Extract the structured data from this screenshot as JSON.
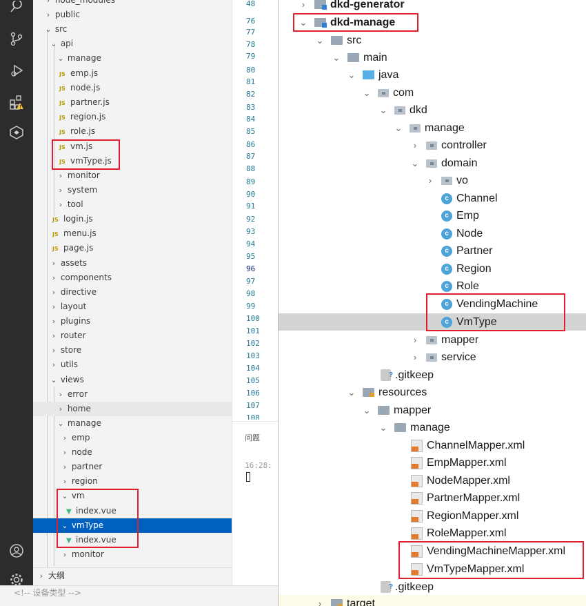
{
  "explorer": {
    "rows": [
      "node_modules",
      "public",
      "src",
      "api",
      "manage",
      "emp.js",
      "node.js",
      "partner.js",
      "region.js",
      "role.js",
      "vm.js",
      "vmType.js",
      "monitor",
      "system",
      "tool",
      "login.js",
      "menu.js",
      "page.js",
      "assets",
      "components",
      "directive",
      "layout",
      "plugins",
      "router",
      "store",
      "utils",
      "views",
      "error",
      "home",
      "manage",
      "emp",
      "node",
      "partner",
      "region",
      "vm",
      "index.vue",
      "vmType",
      "index.vue",
      "monitor"
    ],
    "outline_label": "大纲",
    "bottom_comment": "<!-- 设备类型 -->",
    "js_badge": "JS"
  },
  "gutter": {
    "lines": [
      "48",
      "76",
      "77",
      "78",
      "79",
      "80",
      "81",
      "82",
      "83",
      "84",
      "85",
      "86",
      "87",
      "88",
      "89",
      "90",
      "91",
      "92",
      "93",
      "94",
      "95",
      "96",
      "97",
      "98",
      "99",
      "100",
      "101",
      "102",
      "103",
      "104",
      "105",
      "106",
      "107",
      "108"
    ],
    "problems_label": "问题",
    "time_label": "16:28:"
  },
  "project": {
    "rows": [
      "dkd-generator",
      "dkd-manage",
      "src",
      "main",
      "java",
      "com",
      "dkd",
      "manage",
      "controller",
      "domain",
      "vo",
      "Channel",
      "Emp",
      "Node",
      "Partner",
      "Region",
      "Role",
      "VendingMachine",
      "VmType",
      "mapper",
      "service",
      ".gitkeep",
      "resources",
      "mapper",
      "manage",
      "ChannelMapper.xml",
      "EmpMapper.xml",
      "NodeMapper.xml",
      "PartnerMapper.xml",
      "RegionMapper.xml",
      "RoleMapper.xml",
      "VendingMachineMapper.xml",
      "VmTypeMapper.xml",
      ".gitkeep",
      "target"
    ],
    "class_badge": "c"
  },
  "colors": {
    "selection": "#0060c0",
    "highlight_box": "#e0202e",
    "activity_bar": "#2c2c2c"
  }
}
